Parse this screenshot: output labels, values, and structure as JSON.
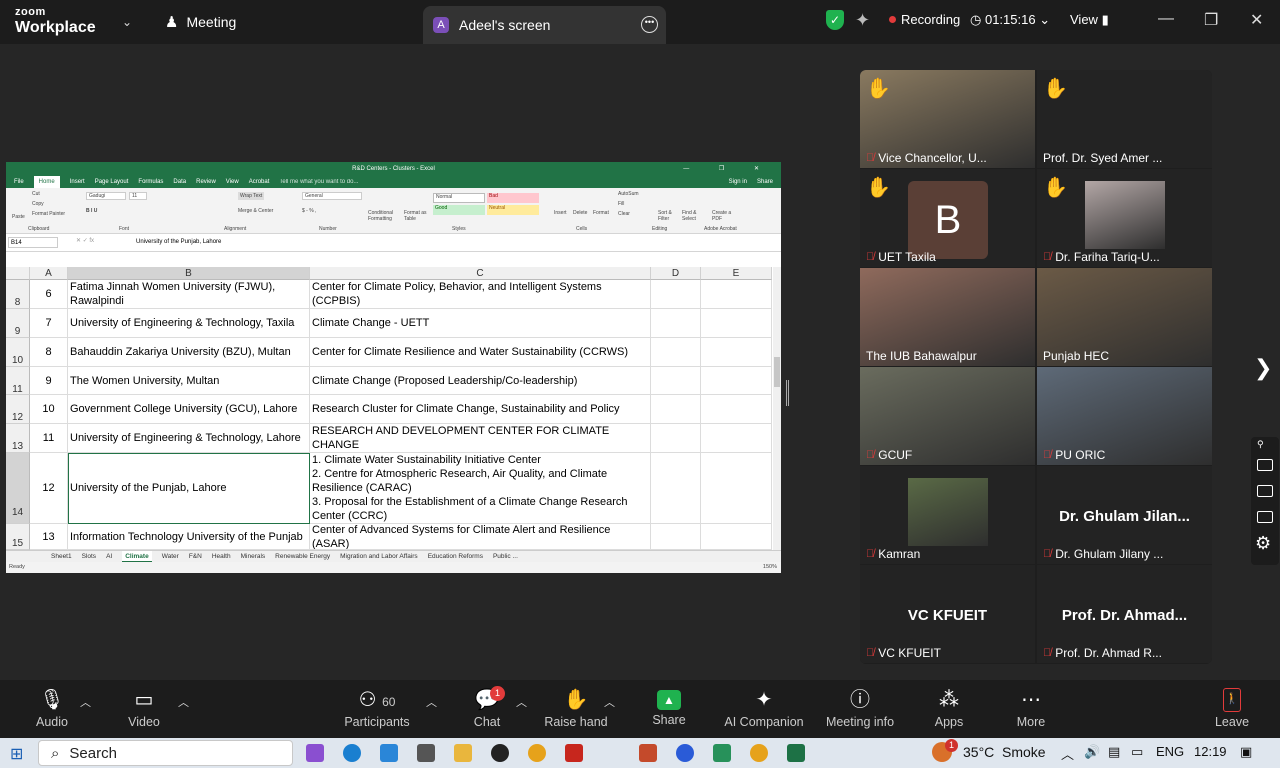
{
  "titlebar": {
    "logo_top": "zoom",
    "logo_bottom": "Workplace",
    "meeting_label": "Meeting",
    "screen_avatar": "A",
    "screen_label": "Adeel's screen",
    "recording": "Recording",
    "timer": "01:15:16",
    "view": "View"
  },
  "excel": {
    "window_title": "R&D Centers - Clusters - Excel",
    "menu": [
      "File",
      "Home",
      "Insert",
      "Page Layout",
      "Formulas",
      "Data",
      "Review",
      "View",
      "Acrobat",
      "Tell me what you want to do..."
    ],
    "signin": "Sign in",
    "share": "Share",
    "ribbon": {
      "cut": "Cut",
      "copy": "Copy",
      "paint": "Format Painter",
      "paste": "Paste",
      "font": "Gadugi",
      "size": "11",
      "wrap": "Wrap Text",
      "merge": "Merge & Center",
      "numfmt": "General",
      "cond": "Conditional Formatting",
      "fmt_table": "Format as Table",
      "style_normal": "Normal",
      "style_bad": "Bad",
      "style_good": "Good",
      "style_neutral": "Neutral",
      "insert": "Insert",
      "delete": "Delete",
      "format": "Format",
      "autosum": "AutoSum",
      "fill": "Fill",
      "clear": "Clear",
      "sort": "Sort & Filter",
      "find": "Find & Select",
      "pdf": "Create a PDF",
      "groups": [
        "Clipboard",
        "Font",
        "Alignment",
        "Number",
        "Styles",
        "Cells",
        "Editing",
        "Adobe Acrobat"
      ]
    },
    "namebox": "B14",
    "formula": "University of the Punjab, Lahore",
    "columns": [
      "A",
      "B",
      "C",
      "D",
      "E"
    ],
    "rows": [
      {
        "row": "8",
        "a": "6",
        "b": "Fatima Jinnah Women University (FJWU), Rawalpindi",
        "c": "Center for Climate Policy, Behavior, and Intelligent Systems (CCPBIS)"
      },
      {
        "row": "9",
        "a": "7",
        "b": "University of Engineering & Technology, Taxila",
        "c": "Climate Change - UETT"
      },
      {
        "row": "10",
        "a": "8",
        "b": "Bahauddin Zakariya University (BZU), Multan",
        "c": "Center for Climate Resilience and Water Sustainability (CCRWS)"
      },
      {
        "row": "11",
        "a": "9",
        "b": "The Women University, Multan",
        "c": "Climate Change (Proposed Leadership/Co-leadership)"
      },
      {
        "row": "12",
        "a": "10",
        "b": "Government College University (GCU), Lahore",
        "c": "Research Cluster for Climate Change, Sustainability and Policy"
      },
      {
        "row": "13",
        "a": "11",
        "b": "University of Engineering & Technology, Lahore",
        "c": "RESEARCH AND DEVELOPMENT CENTER FOR CLIMATE CHANGE"
      },
      {
        "row": "14",
        "a": "12",
        "b": "University of the Punjab, Lahore",
        "c": "1. Climate Water Sustainability Initiative Center\n2. Centre for Atmospheric Research, Air Quality, and Climate Resilience (CARAC)\n3. Proposal for the Establishment of a Climate Change Research Center (CCRC)"
      },
      {
        "row": "15",
        "a": "13",
        "b": "Information Technology University of the Punjab",
        "c": "Center of Advanced Systems for Climate Alert and Resilience (ASAR)"
      }
    ],
    "sheets": [
      "Sheet1",
      "Slots",
      "AI",
      "Climate",
      "Water",
      "F&N",
      "Health",
      "Minerals",
      "Renewable Energy",
      "Migration and Labor Affairs",
      "Education Reforms",
      "Public ..."
    ],
    "status": "Ready",
    "zoom": "150%"
  },
  "participants": [
    {
      "name": "Vice Chancellor, U...",
      "hand": true,
      "muted": true,
      "kind": "photo",
      "photo_color": "#8a7a60"
    },
    {
      "name": "Prof. Dr. Syed Amer ...",
      "hand": true,
      "muted": false,
      "kind": "blank"
    },
    {
      "name": "UET Taxila",
      "hand": true,
      "muted": true,
      "kind": "avatar",
      "avatar": "B"
    },
    {
      "name": "Dr. Fariha Tariq-U...",
      "hand": true,
      "muted": true,
      "kind": "photo",
      "photo_color": "#b3a7a6"
    },
    {
      "name": "The IUB Bahawalpur",
      "hand": false,
      "muted": false,
      "kind": "photo",
      "photo_color": "#8f6a5c",
      "active": true
    },
    {
      "name": "Punjab HEC",
      "hand": false,
      "muted": false,
      "kind": "photo",
      "photo_color": "#6b5a46"
    },
    {
      "name": "GCUF",
      "hand": false,
      "muted": true,
      "kind": "photo",
      "photo_color": "#6a6c5e"
    },
    {
      "name": "PU ORIC",
      "hand": false,
      "muted": true,
      "kind": "photo",
      "photo_color": "#5e6a78"
    },
    {
      "name": "Kamran",
      "hand": false,
      "muted": true,
      "kind": "photo",
      "photo_color": "#5a6a46"
    },
    {
      "name": "Dr. Ghulam Jilany ...",
      "hand": false,
      "muted": true,
      "kind": "text",
      "big": "Dr. Ghulam Jilan..."
    },
    {
      "name": "VC KFUEIT",
      "hand": false,
      "muted": true,
      "kind": "text",
      "big": "VC KFUEIT"
    },
    {
      "name": "Prof. Dr. Ahmad R...",
      "hand": false,
      "muted": true,
      "kind": "text",
      "big": "Prof. Dr. Ahmad..."
    }
  ],
  "toolbar": {
    "audio": "Audio",
    "video": "Video",
    "participants": "Participants",
    "participants_count": "60",
    "chat": "Chat",
    "chat_badge": "1",
    "raise_hand": "Raise hand",
    "share": "Share",
    "ai": "AI Companion",
    "info": "Meeting info",
    "apps": "Apps",
    "more": "More",
    "leave": "Leave"
  },
  "taskbar": {
    "search": "Search",
    "weather_badge": "1",
    "temp": "35°C",
    "condition": "Smoke",
    "lang": "ENG",
    "time": "12:19"
  },
  "icons": {
    "mic": "mic-icon",
    "video": "video-icon",
    "hand": "hand-icon",
    "windows": "windows-logo-icon"
  }
}
